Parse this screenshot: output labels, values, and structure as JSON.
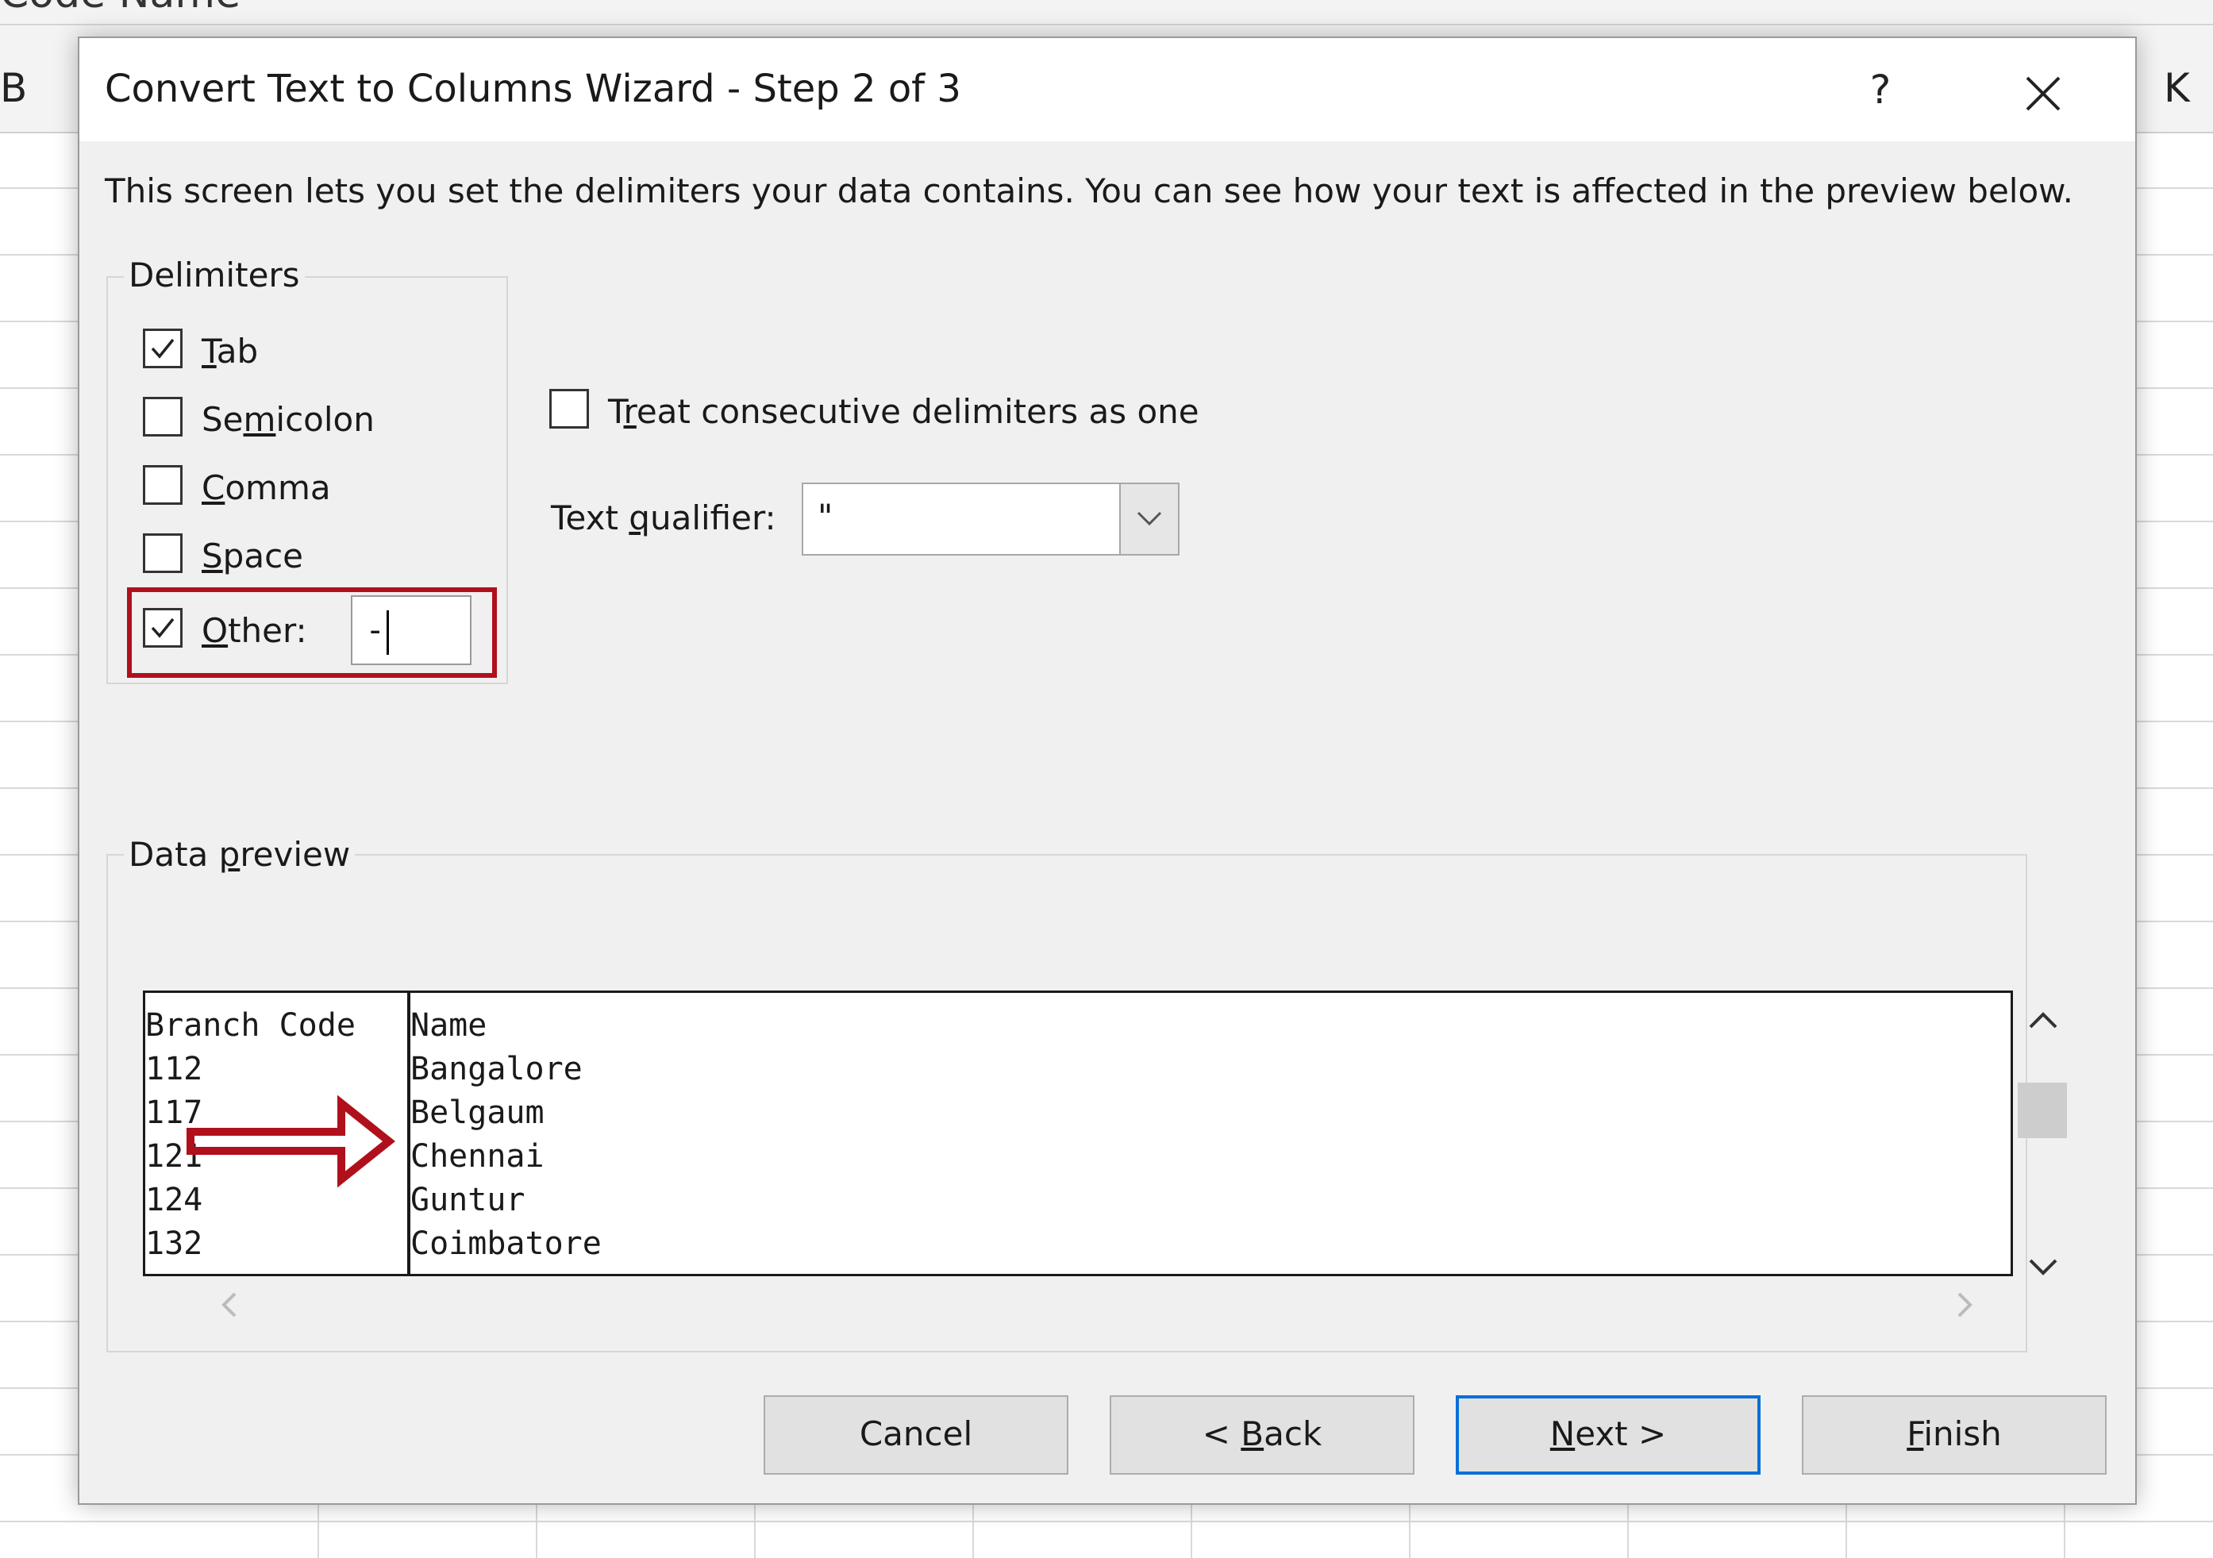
{
  "sheet": {
    "top_cell_text": "Code Name",
    "col_left_label": "B",
    "col_right_label": "K"
  },
  "dialog": {
    "title": "Convert Text to Columns Wizard - Step 2 of 3",
    "help_label": "?",
    "intro": "This screen lets you set the delimiters your data contains.  You can see how your text is affected in the preview below."
  },
  "delimiters": {
    "group_label": "Delimiters",
    "tab": {
      "label_u": "T",
      "label_rest": "ab",
      "checked": true
    },
    "semicolon": {
      "label_pre": "Se",
      "label_u": "m",
      "label_rest": "icolon",
      "checked": false
    },
    "comma": {
      "label_u": "C",
      "label_rest": "omma",
      "checked": false
    },
    "space": {
      "label_u": "S",
      "label_rest": "pace",
      "checked": false
    },
    "other": {
      "label_u": "O",
      "label_rest": "ther:",
      "checked": true,
      "value": "-"
    }
  },
  "options": {
    "consecutive_pre": "T",
    "consecutive_u": "r",
    "consecutive_rest": "eat consecutive delimiters as one",
    "consecutive_checked": false,
    "qualifier_pre": "Text ",
    "qualifier_u": "q",
    "qualifier_rest": "ualifier:",
    "qualifier_value": "\""
  },
  "preview": {
    "label_pre": "Data ",
    "label_u": "p",
    "label_rest": "review",
    "column1": [
      "Branch Code",
      "112",
      "117",
      "121",
      "124",
      "132"
    ],
    "column2": [
      "Name",
      "Bangalore",
      "Belgaum",
      "Chennai",
      "Guntur",
      "Coimbatore"
    ]
  },
  "buttons": {
    "cancel": "Cancel",
    "back_pre": "< ",
    "back_u": "B",
    "back_rest": "ack",
    "next_u": "N",
    "next_rest": "ext >",
    "finish_u": "F",
    "finish_rest": "inish"
  },
  "colors": {
    "highlight_red": "#b0101c",
    "primary_blue": "#0a6fd6"
  }
}
